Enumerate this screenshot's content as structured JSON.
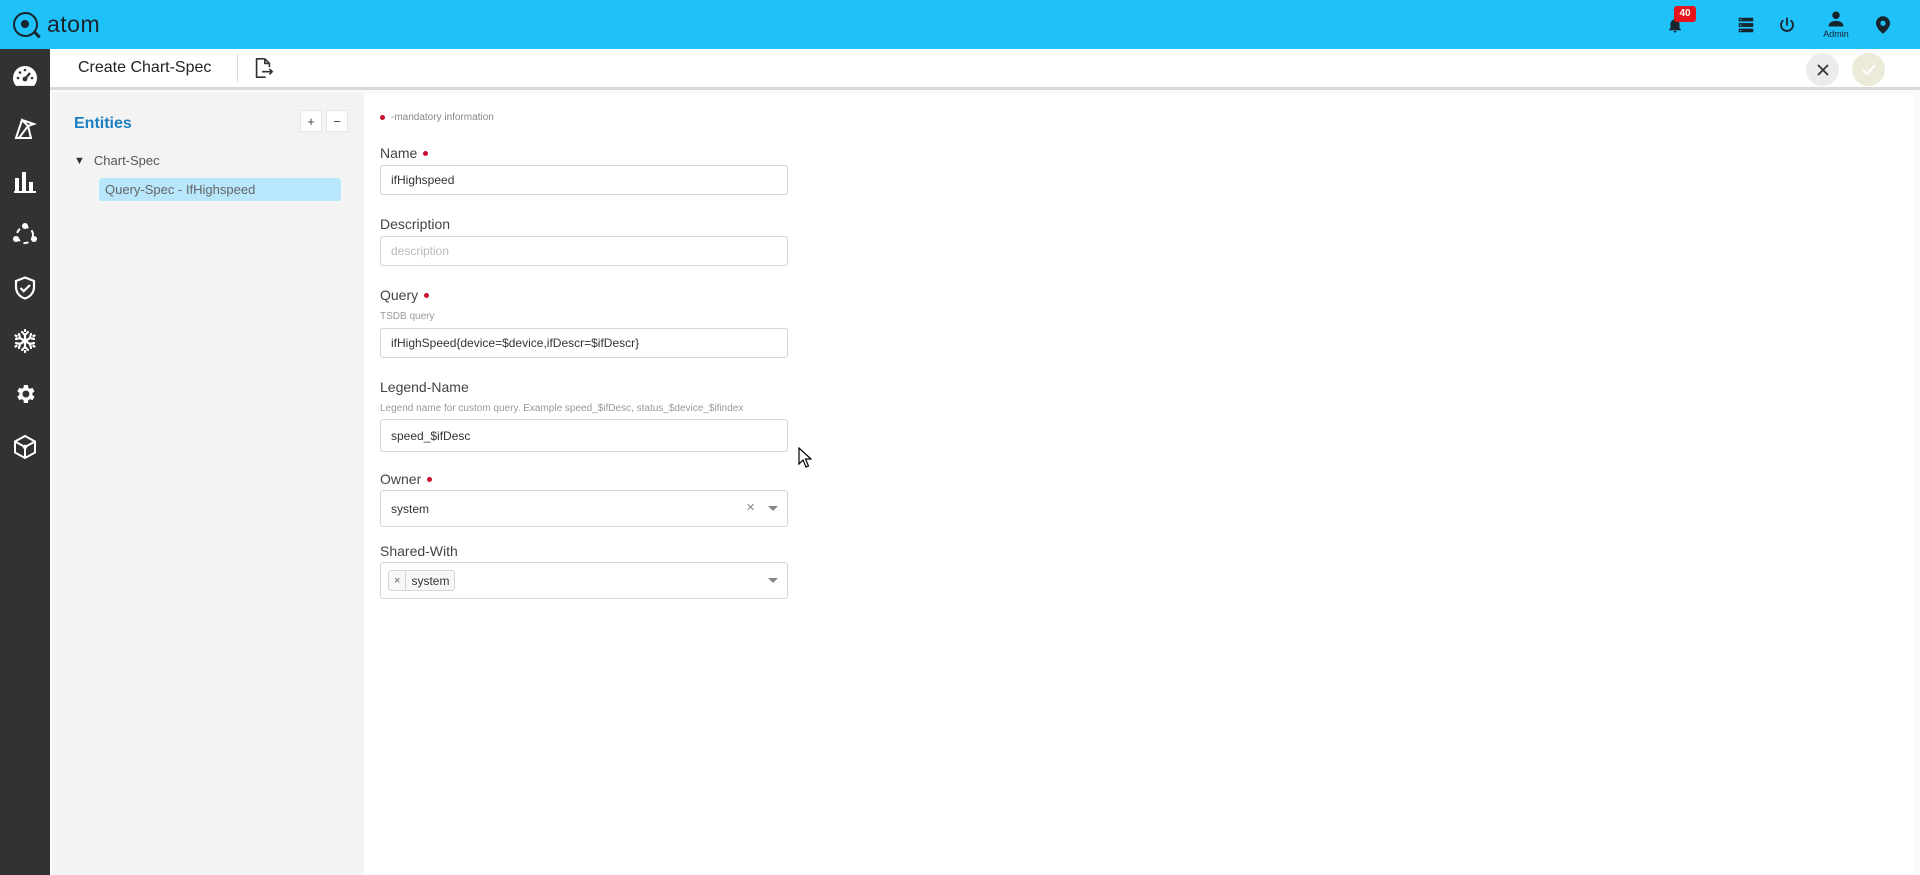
{
  "app": {
    "logo_text": "atom"
  },
  "topbar": {
    "notification_count": "40",
    "admin_label": "Admin"
  },
  "subheader": {
    "title": "Create Chart-Spec"
  },
  "entities": {
    "title": "Entities",
    "add_label": "+",
    "remove_label": "−",
    "root_label": "Chart-Spec",
    "selected_item": "Query-Spec - IfHighspeed"
  },
  "form": {
    "mandatory_note": "-mandatory information",
    "name": {
      "label": "Name",
      "value": "ifHighspeed"
    },
    "description": {
      "label": "Description",
      "placeholder": "description",
      "value": ""
    },
    "query": {
      "label": "Query",
      "hint": "TSDB query",
      "value": "ifHighSpeed{device=$device,ifDescr=$ifDescr}"
    },
    "legend": {
      "label": "Legend-Name",
      "hint": "Legend name for custom query. Example speed_$ifDesc, status_$device_$ifindex",
      "value": "speed_$ifDesc"
    },
    "owner": {
      "label": "Owner",
      "value": "system",
      "clear_label": "×"
    },
    "shared_with": {
      "label": "Shared-With",
      "tags": [
        "system"
      ],
      "remove_label": "×"
    }
  },
  "colors": {
    "topbar": "#1fc1f9",
    "rail": "#323232",
    "accent_blue": "#1c7fc0",
    "selection": "#b8e7fc",
    "mandatory_dot": "#c8102e",
    "badge": "#e8141b"
  }
}
